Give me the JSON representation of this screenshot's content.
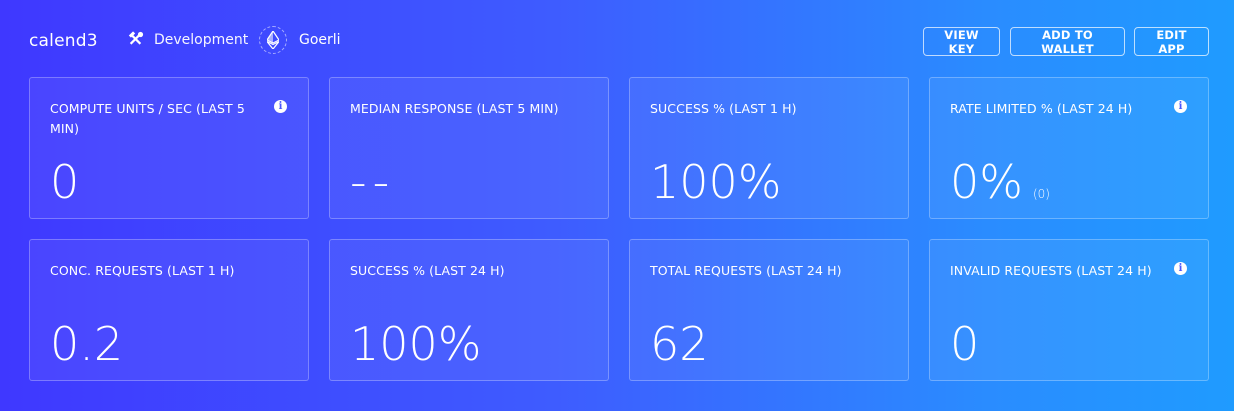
{
  "header": {
    "app_name": "calend3",
    "environment": {
      "label": "Development",
      "icon": "hammer-wrench-icon"
    },
    "network": {
      "label": "Goerli",
      "icon": "ethereum-icon"
    },
    "buttons": {
      "view_key": "VIEW KEY",
      "add_to_wallet": "ADD TO WALLET",
      "edit_app": "EDIT APP"
    }
  },
  "cards": [
    {
      "title": "COMPUTE UNITS / SEC (LAST 5 MIN)",
      "value": "0",
      "info": true
    },
    {
      "title": "MEDIAN RESPONSE (LAST 5 MIN)",
      "value": "--",
      "info": false
    },
    {
      "title": "SUCCESS % (LAST 1 H)",
      "value": "100%",
      "info": false
    },
    {
      "title": "RATE LIMITED % (LAST 24 H)",
      "value": "0%",
      "sub": "(0)",
      "info": true
    },
    {
      "title": "CONC. REQUESTS (LAST 1 H)",
      "value": "0.2",
      "info": false
    },
    {
      "title": "SUCCESS % (LAST 24 H)",
      "value": "100%",
      "info": false
    },
    {
      "title": "TOTAL REQUESTS (LAST 24 H)",
      "value": "62",
      "info": false
    },
    {
      "title": "INVALID REQUESTS (LAST 24 H)",
      "value": "0",
      "info": true
    }
  ],
  "colors": {
    "gradient_start": "#3f38ff",
    "gradient_end": "#1f9bff",
    "text": "#ffffff"
  }
}
